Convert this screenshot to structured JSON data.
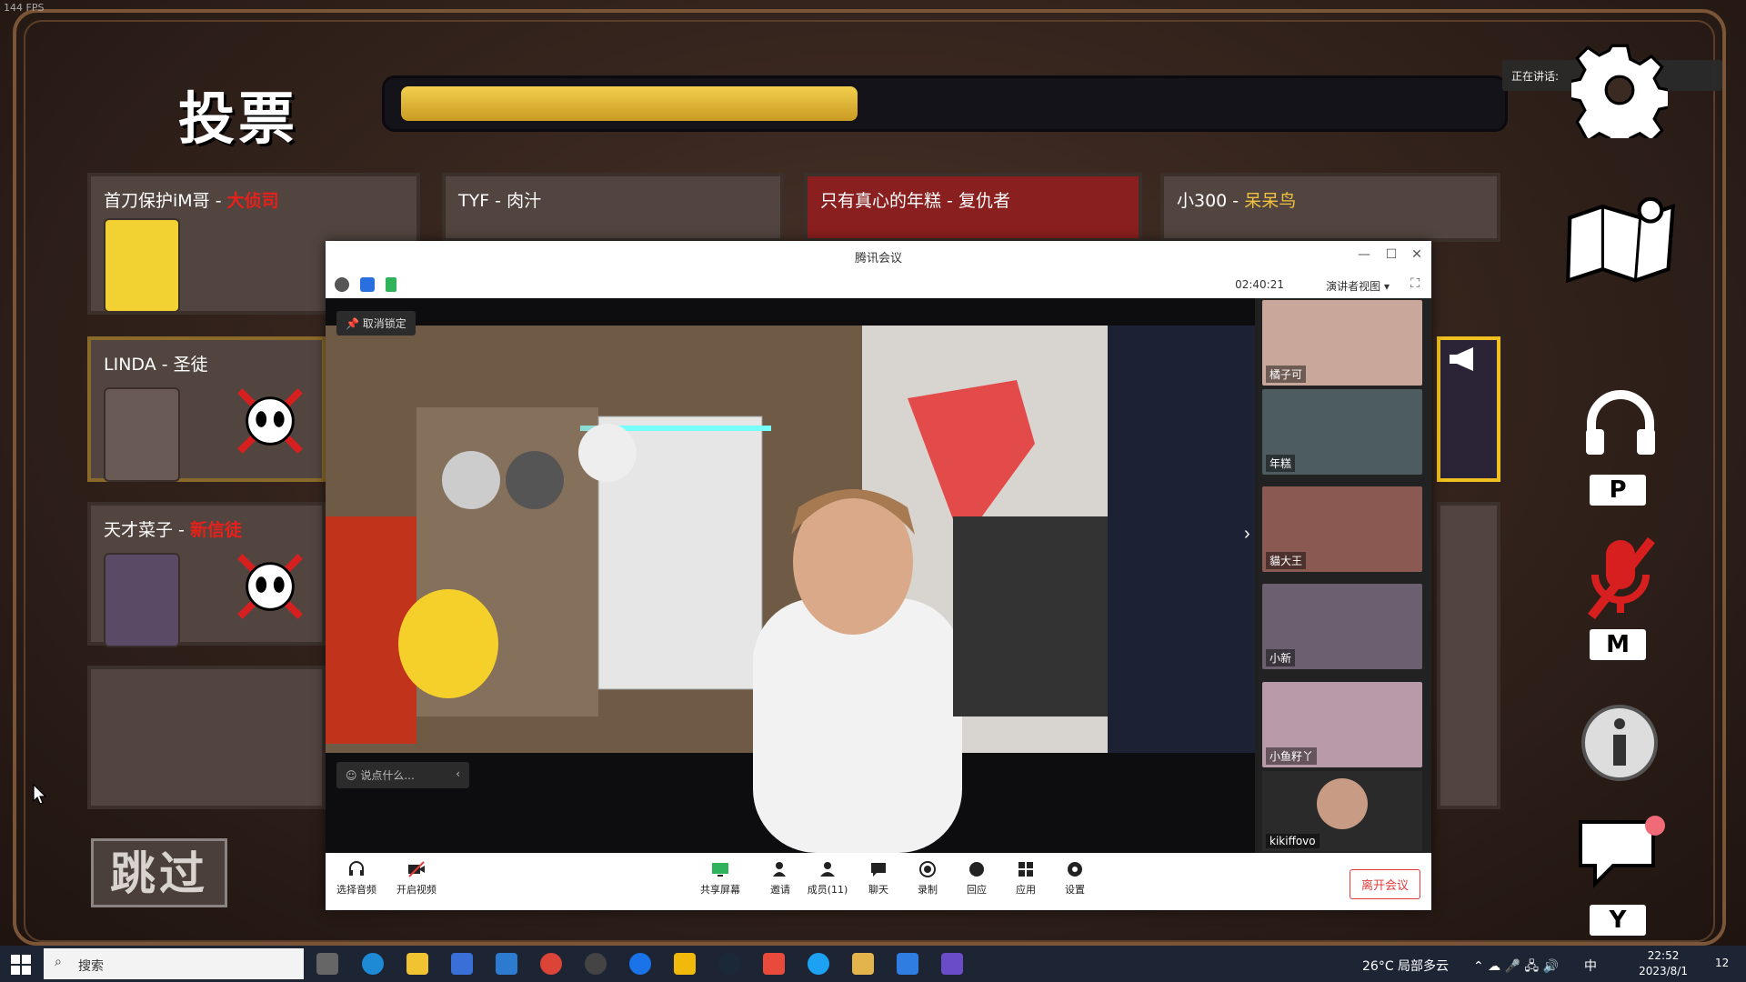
{
  "hud": {
    "fps": "144 FPS"
  },
  "vote": {
    "title": "投票",
    "progress_fraction": 0.42,
    "speaking_label": "正在讲话:",
    "skip_label": "跳过"
  },
  "players": [
    {
      "name": "首刀保护iM哥",
      "sep": " - ",
      "role": "大侦司",
      "role_color": "red"
    },
    {
      "name": "TYF",
      "sep": " - ",
      "role": "肉汁",
      "role_color": "white"
    },
    {
      "name": "只有真心的年糕",
      "sep": " - ",
      "role": "复仇者",
      "role_color": "white"
    },
    {
      "name": "小300",
      "sep": " - ",
      "role": "呆呆鸟",
      "role_color": "yellow"
    },
    {
      "name": "LINDA",
      "sep": " - ",
      "role": "圣徒",
      "role_color": "white"
    },
    {
      "name": "天才菜子",
      "sep": " - ",
      "role": "新信徒",
      "role_color": "red"
    }
  ],
  "side_keys": {
    "push_to_talk": "P",
    "mute": "M",
    "chat": "Y"
  },
  "meeting": {
    "title": "腾讯会议",
    "elapsed": "02:40:21",
    "view_label": "演讲者视图",
    "unlock_label": "取消锁定",
    "chat_placeholder": "说点什么...",
    "participants": [
      {
        "name": "橘子可"
      },
      {
        "name": "年糕"
      },
      {
        "name": "貓大王"
      },
      {
        "name": "小新"
      },
      {
        "name": "小鱼籽丫"
      },
      {
        "name": "kikiffovo"
      }
    ],
    "toolbar": {
      "audio": "选择音频",
      "video": "开启视频",
      "share": "共享屏幕",
      "invite": "邀请",
      "members": "成员(11)",
      "chat": "聊天",
      "record": "录制",
      "react": "回应",
      "apps": "应用",
      "settings": "设置",
      "leave": "离开会议"
    }
  },
  "taskbar": {
    "search_placeholder": "搜索",
    "weather": "26°C 局部多云",
    "ime": "中",
    "time": "22:52",
    "date": "2023/8/1",
    "notifications": "12"
  }
}
